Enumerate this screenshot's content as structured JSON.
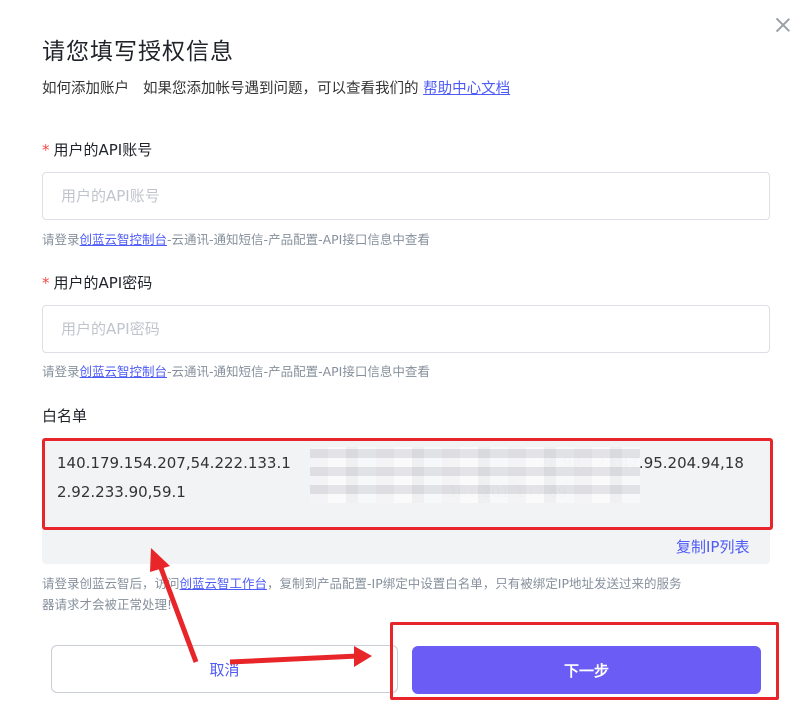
{
  "dialog": {
    "title": "请您填写授权信息",
    "subtitle_prefix": "如何添加账户",
    "subtitle_text": "如果您添加帐号遇到问题，可以查看我们的",
    "help_link": "帮助中心文档"
  },
  "fields": {
    "account": {
      "required_mark": "*",
      "label": "用户的API账号",
      "placeholder": "用户的API账号",
      "hint_prefix": "请登录",
      "hint_link": "创蓝云智控制台",
      "hint_suffix": "-云通讯-通知短信-产品配置-API接口信息中查看"
    },
    "password": {
      "required_mark": "*",
      "label": "用户的API密码",
      "placeholder": "用户的API密码",
      "hint_prefix": "请登录",
      "hint_link": "创蓝云智控制台",
      "hint_suffix": "-云通讯-通知短信-产品配置-API接口信息中查看"
    },
    "whitelist": {
      "label": "白名单",
      "value": "140.179.154.207,54.222.133.1                                                    26.98.123,47.95.204.94,182.92.233.90,59.1                                                       101.201.147.89",
      "copy_label": "复制IP列表",
      "hint_prefix": "请登录创蓝云智后，访问",
      "hint_link": "创蓝云智工作台",
      "hint_suffix_line1": "，复制到产品配置-IP绑定中设置白名单，只有被绑定IP地址发送过来的服务",
      "hint_suffix_line2": "器请求才会被正常处理!"
    }
  },
  "buttons": {
    "cancel": "取消",
    "next": "下一步"
  },
  "colors": {
    "accent": "#4e5bf6",
    "primary_button": "#6b5cf6",
    "required": "#f54a45",
    "annotation_red": "#e8262a"
  },
  "icons": {
    "close": "close-icon"
  }
}
